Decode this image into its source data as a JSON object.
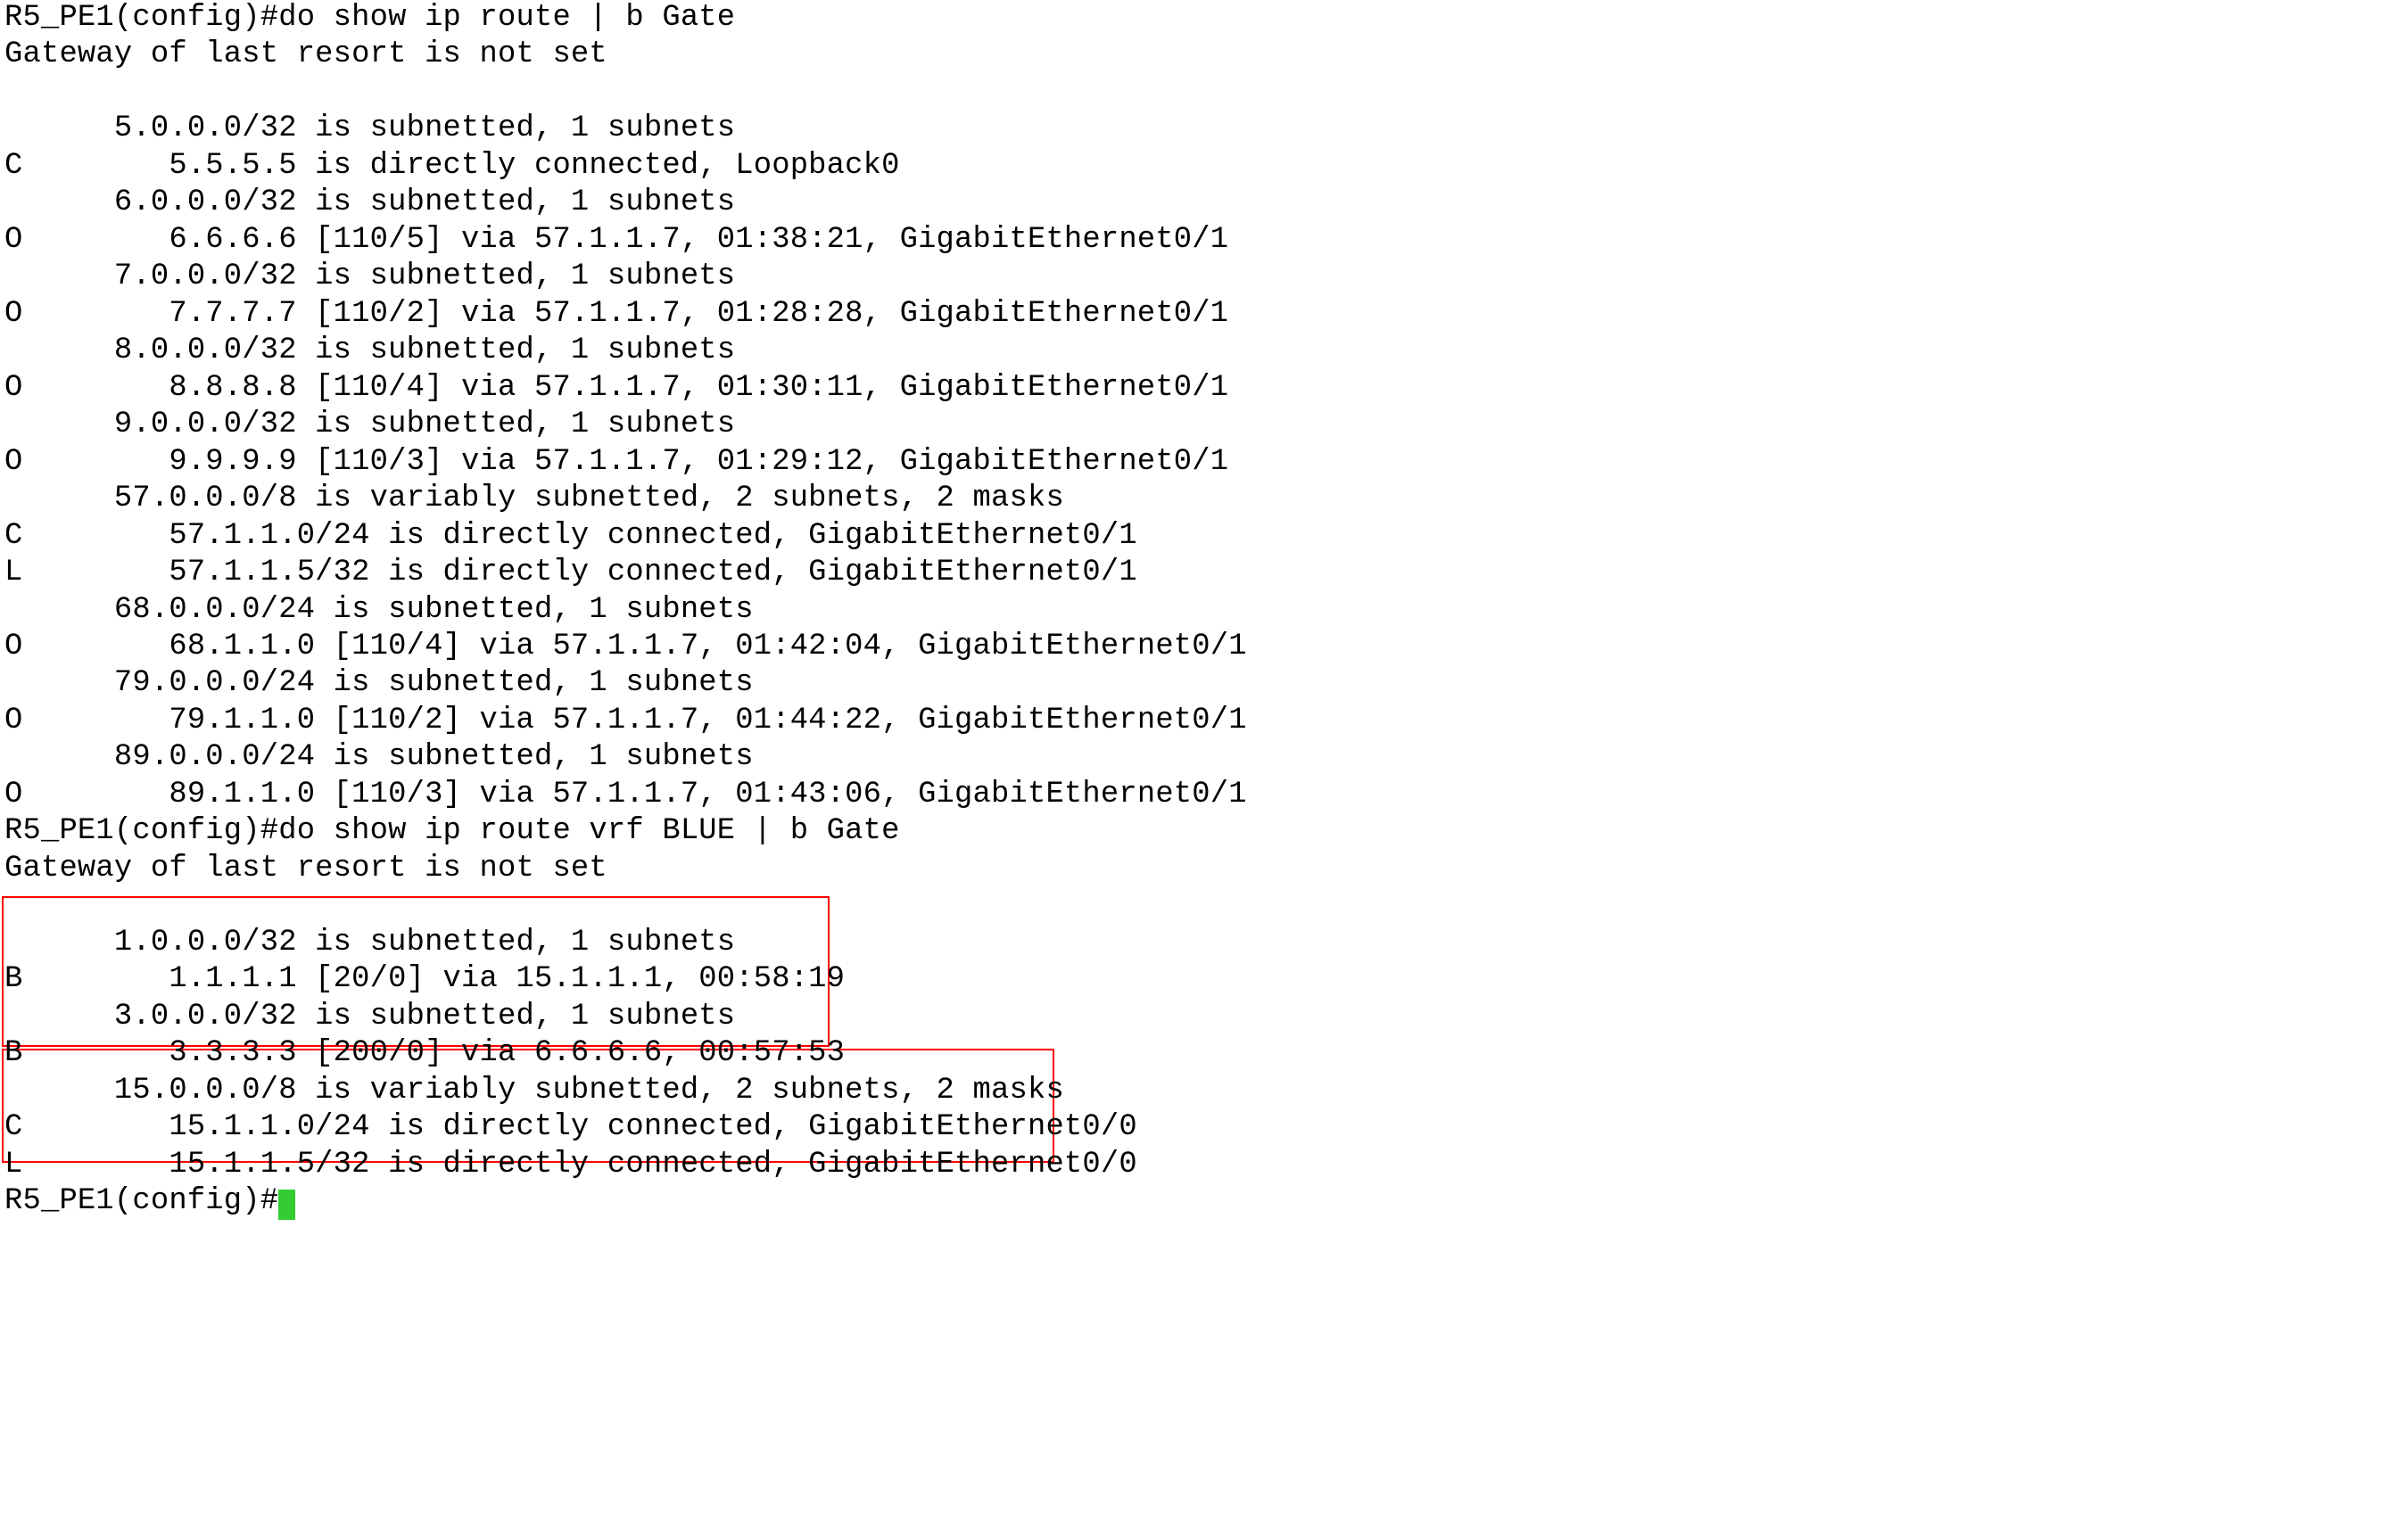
{
  "prompt1": "R5_PE1(config)#do show ip route | b Gate",
  "gateway1": "Gateway of last resort is not set",
  "blank1": "",
  "global_routes": [
    "      5.0.0.0/32 is subnetted, 1 subnets",
    "C        5.5.5.5 is directly connected, Loopback0",
    "      6.0.0.0/32 is subnetted, 1 subnets",
    "O        6.6.6.6 [110/5] via 57.1.1.7, 01:38:21, GigabitEthernet0/1",
    "      7.0.0.0/32 is subnetted, 1 subnets",
    "O        7.7.7.7 [110/2] via 57.1.1.7, 01:28:28, GigabitEthernet0/1",
    "      8.0.0.0/32 is subnetted, 1 subnets",
    "O        8.8.8.8 [110/4] via 57.1.1.7, 01:30:11, GigabitEthernet0/1",
    "      9.0.0.0/32 is subnetted, 1 subnets",
    "O        9.9.9.9 [110/3] via 57.1.1.7, 01:29:12, GigabitEthernet0/1",
    "      57.0.0.0/8 is variably subnetted, 2 subnets, 2 masks",
    "C        57.1.1.0/24 is directly connected, GigabitEthernet0/1",
    "L        57.1.1.5/32 is directly connected, GigabitEthernet0/1",
    "      68.0.0.0/24 is subnetted, 1 subnets",
    "O        68.1.1.0 [110/4] via 57.1.1.7, 01:42:04, GigabitEthernet0/1",
    "      79.0.0.0/24 is subnetted, 1 subnets",
    "O        79.1.1.0 [110/2] via 57.1.1.7, 01:44:22, GigabitEthernet0/1",
    "      89.0.0.0/24 is subnetted, 1 subnets",
    "O        89.1.1.0 [110/3] via 57.1.1.7, 01:43:06, GigabitEthernet0/1"
  ],
  "prompt2": "R5_PE1(config)#do show ip route vrf BLUE | b Gate",
  "gateway2": "Gateway of last resort is not set",
  "blank2": "",
  "vrf_box1": [
    "      1.0.0.0/32 is subnetted, 1 subnets",
    "B        1.1.1.1 [20/0] via 15.1.1.1, 00:58:19",
    "      3.0.0.0/32 is subnetted, 1 subnets",
    "B        3.3.3.3 [200/0] via 6.6.6.6, 00:57:53"
  ],
  "vrf_box2": [
    "      15.0.0.0/8 is variably subnetted, 2 subnets, 2 masks",
    "C        15.1.1.0/24 is directly connected, GigabitEthernet0/0",
    "L        15.1.1.5/32 is directly connected, GigabitEthernet0/0"
  ],
  "prompt3": "R5_PE1(config)#",
  "box1_css": "top: 1005px; left: 2px; width: 924px; height: 165px;",
  "box2_css": "top: 1176px; left: 2px; width: 1176px; height: 124px;"
}
